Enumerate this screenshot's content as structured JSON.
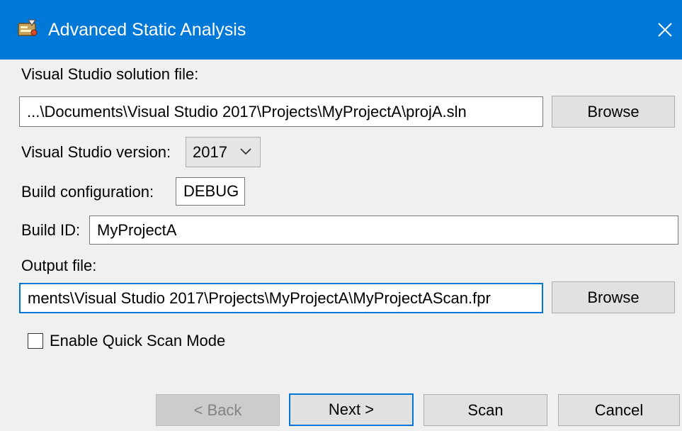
{
  "window": {
    "title": "Advanced Static Analysis",
    "app_icon": "scanner-app-icon",
    "close_icon": "close-icon",
    "accent_color": "#0078d7"
  },
  "solution": {
    "label": "Visual Studio solution file:",
    "value": "...\\Documents\\Visual Studio 2017\\Projects\\MyProjectA\\projA.sln",
    "browse_label": "Browse"
  },
  "vs_version": {
    "label": "Visual Studio version:",
    "selected": "2017"
  },
  "build_config": {
    "label": "Build configuration:",
    "value": "DEBUG"
  },
  "build_id": {
    "label": "Build ID:",
    "value": "MyProjectA"
  },
  "output": {
    "label": "Output file:",
    "value": "ments\\Visual Studio 2017\\Projects\\MyProjectA\\MyProjectAScan.fpr",
    "browse_label": "Browse"
  },
  "quick_scan": {
    "label": "Enable Quick Scan Mode",
    "checked": false
  },
  "footer": {
    "back_label": "< Back",
    "next_label": "Next >",
    "scan_label": "Scan",
    "cancel_label": "Cancel"
  }
}
